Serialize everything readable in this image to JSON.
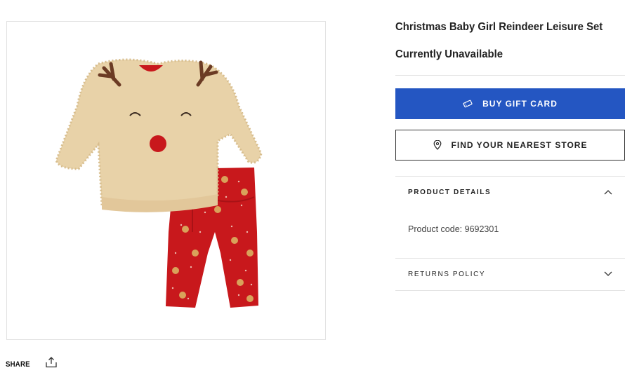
{
  "product": {
    "title": "Christmas Baby Girl Reindeer Leisure Set",
    "availability": "Currently Unavailable",
    "image_alt": "Christmas Baby Girl Reindeer Leisure Set – beige sherpa reindeer sweatshirt and red printed leggings"
  },
  "actions": {
    "buy_gift_card": "BUY GIFT CARD",
    "find_store": "FIND YOUR NEAREST STORE",
    "share": "SHARE"
  },
  "accordion": {
    "details_label": "PRODUCT DETAILS",
    "product_code_label": "Product code:",
    "product_code_value": "9692301",
    "returns_label": "RETURNS POLICY"
  },
  "colors": {
    "primary_button": "#2456c2",
    "divider": "#e3e3e3"
  },
  "icons": {
    "gift_card": "ticket-icon",
    "store": "map-pin-icon",
    "details_toggle": "chevron-up-icon",
    "returns_toggle": "chevron-down-icon",
    "share": "share-upload-icon"
  }
}
